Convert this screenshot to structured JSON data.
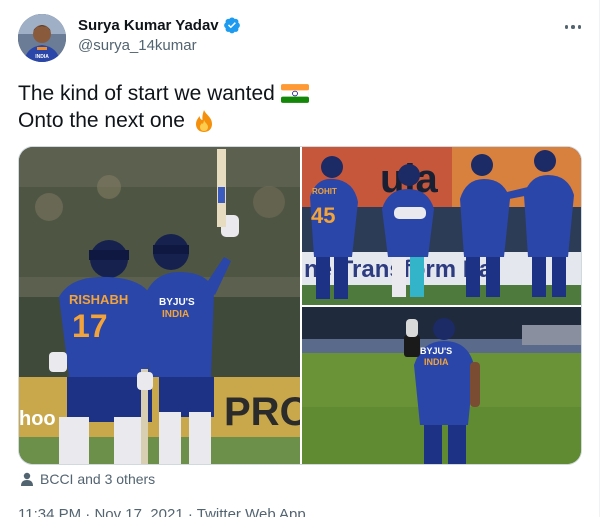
{
  "author": {
    "name": "Surya Kumar Yadav",
    "handle": "@surya_14kumar",
    "verified_icon": "verified-badge-icon",
    "avatar_icon": "avatar-photo"
  },
  "tweet": {
    "line1": "The kind of start we wanted",
    "line1_emoji": "indian-flag-icon",
    "line2": "Onto the next one",
    "line2_emoji": "fire-icon"
  },
  "media": {
    "photo1_jersey_name": "RISHABH",
    "photo1_jersey_number": "17",
    "photo1_board": "PRO",
    "photo1_board_left": "hoo",
    "photo1_sponsor": "BYJU'S",
    "photo1_team": "INDIA",
    "photo2_banner_top": "uja",
    "photo2_banner_bottom": "ne Transform Pa",
    "photo2_jersey_name": "ROHIT",
    "photo2_jersey_number": "45",
    "photo3_sponsor": "BYJU'S",
    "photo3_team": "INDIA"
  },
  "tagged": {
    "label": "BCCI and 3 others",
    "icon": "person-icon"
  },
  "meta": {
    "time": "11:34 PM",
    "separator": "·",
    "date": "Nov 17, 2021",
    "source": "Twitter Web App"
  },
  "colors": {
    "text": "#0f1419",
    "secondary": "#536471",
    "verified": "#1d9bf0",
    "border": "#cfd9de",
    "jersey": "#2a46a8"
  }
}
